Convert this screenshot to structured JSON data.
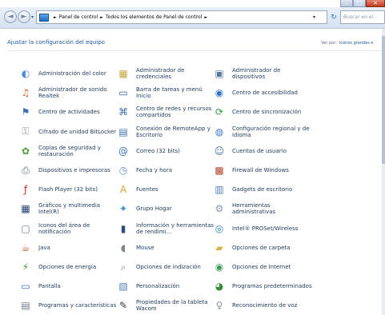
{
  "window": {
    "minimize": "–",
    "maximize": "□",
    "close": "✕"
  },
  "nav": {
    "back": "◄",
    "forward": "►",
    "history": "▾",
    "breadcrumb": [
      "Panel de control",
      "Todos los elementos de Panel de control"
    ],
    "crumb_sep": "►",
    "address_drop": "▾",
    "refresh": "↻",
    "search_placeholder": "Buscar en el..."
  },
  "header": {
    "title": "Ajustar la configuración del equipo",
    "view_by_label": "Ver por:",
    "view_by_value": "Iconos grandes ▾"
  },
  "items": [
    {
      "label": "Administración del color",
      "icon": "◐",
      "color": "#4c8bd6"
    },
    {
      "label": "Administrador de credenciales",
      "icon": "▦",
      "color": "#c9a646"
    },
    {
      "label": "Administrador de dispositivos",
      "icon": "▣",
      "color": "#5b7a9c"
    },
    {
      "label": "Administrador de sonido Realtek",
      "icon": "♫",
      "color": "#d05b2a"
    },
    {
      "label": "Barra de tareas y menú Inicio",
      "icon": "▭",
      "color": "#2a5fa3"
    },
    {
      "label": "Centro de accesibilidad",
      "icon": "◉",
      "color": "#2d74c7"
    },
    {
      "label": "Centro de actividades",
      "icon": "⚑",
      "color": "#3c6fb8"
    },
    {
      "label": "Centro de redes y recursos compartidos",
      "icon": "⌘",
      "color": "#3a6fa8"
    },
    {
      "label": "Centro de sincronización",
      "icon": "⟳",
      "color": "#2f9b3c"
    },
    {
      "label": "Cifrado de unidad BitLocker",
      "icon": "⚿",
      "color": "#8a8f98"
    },
    {
      "label": "Conexión de RemoteApp y Escritorio",
      "icon": "▤",
      "color": "#3d6fae"
    },
    {
      "label": "Configuración regional y de idioma",
      "icon": "◍",
      "color": "#3b7bc8"
    },
    {
      "label": "Copias de seguridad y restauración",
      "icon": "✿",
      "color": "#4f9a3a"
    },
    {
      "label": "Correo (32 bits)",
      "icon": "@",
      "color": "#3a73b5"
    },
    {
      "label": "Cuentas de usuario",
      "icon": "☺",
      "color": "#4a77a8"
    },
    {
      "label": "Dispositivos e impresoras",
      "icon": "⎙",
      "color": "#5f6d80"
    },
    {
      "label": "Fecha y hora",
      "icon": "◷",
      "color": "#5e8fc4"
    },
    {
      "label": "Firewall de Windows",
      "icon": "▩",
      "color": "#b3442c"
    },
    {
      "label": "Flash Player (32 bits)",
      "icon": "ƒ",
      "color": "#c72a1e"
    },
    {
      "label": "Fuentes",
      "icon": "A",
      "color": "#d9a22c"
    },
    {
      "label": "Gadgets de escritorio",
      "icon": "▥",
      "color": "#4e80bb"
    },
    {
      "label": "Gráficos y multimedia Intel(R)",
      "icon": "▦",
      "color": "#1f3f73"
    },
    {
      "label": "Grupo Hogar",
      "icon": "✦",
      "color": "#3c8fd0"
    },
    {
      "label": "Herramientas administrativas",
      "icon": "⚙",
      "color": "#8b97a6"
    },
    {
      "label": "Iconos del área de notificación",
      "icon": "▢",
      "color": "#6c7a8e"
    },
    {
      "label": "Información y herramientas de rendimi...",
      "icon": "▮",
      "color": "#2e4f7a"
    },
    {
      "label": "Intel® PROSet/Wireless",
      "icon": "◎",
      "color": "#2a80d0"
    },
    {
      "label": "Java",
      "icon": "☕",
      "color": "#c0562a"
    },
    {
      "label": "Mouse",
      "icon": "◖",
      "color": "#7d848f"
    },
    {
      "label": "Opciones de carpeta",
      "icon": "▰",
      "color": "#d9b04a"
    },
    {
      "label": "Opciones de energía",
      "icon": "⚡",
      "color": "#3f9a3a"
    },
    {
      "label": "Opciones de indización",
      "icon": "⌕",
      "color": "#7a8592"
    },
    {
      "label": "Opciones de Internet",
      "icon": "◉",
      "color": "#3c9a58"
    },
    {
      "label": "Pantalla",
      "icon": "▭",
      "color": "#3b73b8"
    },
    {
      "label": "Personalización",
      "icon": "▧",
      "color": "#4f7fb5"
    },
    {
      "label": "Programas predeterminados",
      "icon": "◕",
      "color": "#3a8f3a"
    },
    {
      "label": "Programas y características",
      "icon": "▤",
      "color": "#6d7888"
    },
    {
      "label": "Propiedades de la tableta Wacom",
      "icon": "✎",
      "color": "#333333"
    },
    {
      "label": "Reconocimiento de voz",
      "icon": "♀",
      "color": "#8a96a6"
    }
  ]
}
